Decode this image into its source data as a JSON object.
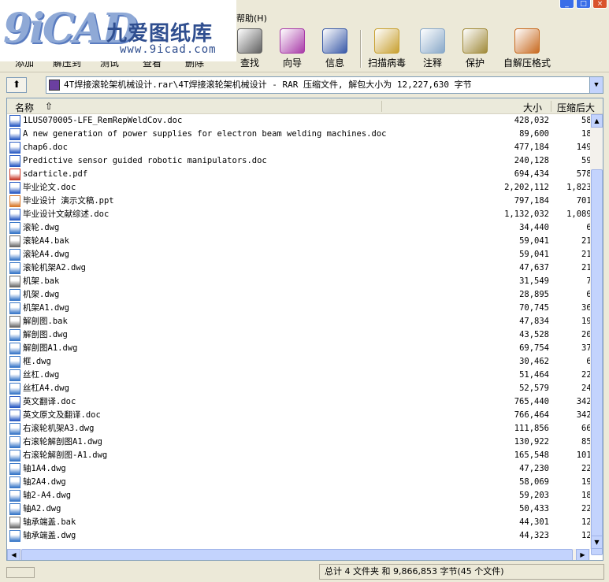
{
  "menu": {
    "help": "帮助(H)"
  },
  "logo": {
    "mark": "9iCAD",
    "cn": "九爱图纸库",
    "url": "www.9icad.com"
  },
  "toolbar": [
    {
      "label": "添加",
      "icon": "add-icon",
      "color": "#5b8a3a"
    },
    {
      "label": "解压到",
      "icon": "extract-icon",
      "color": "#8a6a3a"
    },
    {
      "label": "测试",
      "icon": "test-icon",
      "color": "#7a7a7a"
    },
    {
      "label": "查看",
      "icon": "view-icon",
      "color": "#4a6aa8"
    },
    {
      "label": "删除",
      "icon": "delete-icon",
      "color": "#a83a3a"
    },
    {
      "label": "查找",
      "icon": "find-icon",
      "color": "#606060"
    },
    {
      "label": "向导",
      "icon": "wizard-icon",
      "color": "#a83aa8"
    },
    {
      "label": "信息",
      "icon": "info-icon",
      "color": "#3a5aa8"
    },
    {
      "label": "扫描病毒",
      "icon": "virus-scan-icon",
      "color": "#c8a030"
    },
    {
      "label": "注释",
      "icon": "comment-icon",
      "color": "#88a8c8"
    },
    {
      "label": "保护",
      "icon": "protect-icon",
      "color": "#a08a3a"
    },
    {
      "label": "自解压格式",
      "icon": "sfx-icon",
      "color": "#c86a20"
    }
  ],
  "path": "4T焊接滚轮架机械设计.rar\\4T焊接滚轮架机械设计 - RAR 压缩文件, 解包大小为 12,227,630 字节",
  "columns": {
    "name": "名称",
    "size": "大小",
    "packed": "压缩后大"
  },
  "files": [
    {
      "name": "1LUS070005-LFE_RemRepWeldCov.doc",
      "size": "428,032",
      "packed": "58,",
      "type": "doc"
    },
    {
      "name": "A new generation of power supplies for electron beam welding machines.doc",
      "size": "89,600",
      "packed": "18,",
      "type": "doc"
    },
    {
      "name": "chap6.doc",
      "size": "477,184",
      "packed": "149,",
      "type": "doc"
    },
    {
      "name": "Predictive sensor guided robotic manipulators.doc",
      "size": "240,128",
      "packed": "59,",
      "type": "doc"
    },
    {
      "name": "sdarticle.pdf",
      "size": "694,434",
      "packed": "578,",
      "type": "pdf"
    },
    {
      "name": "毕业论文.doc",
      "size": "2,202,112",
      "packed": "1,823,",
      "type": "doc"
    },
    {
      "name": "毕业设计 演示文稿.ppt",
      "size": "797,184",
      "packed": "701,",
      "type": "ppt"
    },
    {
      "name": "毕业设计文献综述.doc",
      "size": "1,132,032",
      "packed": "1,089,",
      "type": "doc"
    },
    {
      "name": "滚轮.dwg",
      "size": "34,440",
      "packed": "6,",
      "type": "dwg"
    },
    {
      "name": "滚轮A4.bak",
      "size": "59,041",
      "packed": "21,",
      "type": "bak"
    },
    {
      "name": "滚轮A4.dwg",
      "size": "59,041",
      "packed": "21,",
      "type": "dwg"
    },
    {
      "name": "滚轮机架A2.dwg",
      "size": "47,637",
      "packed": "21,",
      "type": "dwg"
    },
    {
      "name": "机架.bak",
      "size": "31,549",
      "packed": "7,",
      "type": "bak"
    },
    {
      "name": "机架.dwg",
      "size": "28,895",
      "packed": "6,",
      "type": "dwg"
    },
    {
      "name": "机架A1.dwg",
      "size": "70,745",
      "packed": "36,",
      "type": "dwg"
    },
    {
      "name": "解剖图.bak",
      "size": "47,834",
      "packed": "19,",
      "type": "bak"
    },
    {
      "name": "解剖图.dwg",
      "size": "43,528",
      "packed": "20,",
      "type": "dwg"
    },
    {
      "name": "解剖图A1.dwg",
      "size": "69,754",
      "packed": "37,",
      "type": "dwg"
    },
    {
      "name": "框.dwg",
      "size": "30,462",
      "packed": "6,",
      "type": "dwg"
    },
    {
      "name": "丝杠.dwg",
      "size": "51,464",
      "packed": "22,",
      "type": "dwg"
    },
    {
      "name": "丝杠A4.dwg",
      "size": "52,579",
      "packed": "24,",
      "type": "dwg"
    },
    {
      "name": "英文翻译.doc",
      "size": "765,440",
      "packed": "342,",
      "type": "doc"
    },
    {
      "name": "英文原文及翻译.doc",
      "size": "766,464",
      "packed": "342,",
      "type": "doc"
    },
    {
      "name": "右滚轮机架A3.dwg",
      "size": "111,856",
      "packed": "66,",
      "type": "dwg"
    },
    {
      "name": "右滚轮解剖图A1.dwg",
      "size": "130,922",
      "packed": "85,",
      "type": "dwg"
    },
    {
      "name": "右滚轮解剖图-A1.dwg",
      "size": "165,548",
      "packed": "101,",
      "type": "dwg"
    },
    {
      "name": "轴1A4.dwg",
      "size": "47,230",
      "packed": "22,",
      "type": "dwg"
    },
    {
      "name": "轴2A4.dwg",
      "size": "58,069",
      "packed": "19,",
      "type": "dwg"
    },
    {
      "name": "轴2-A4.dwg",
      "size": "59,203",
      "packed": "18,",
      "type": "dwg"
    },
    {
      "name": "轴A2.dwg",
      "size": "50,433",
      "packed": "22,",
      "type": "dwg"
    },
    {
      "name": "轴承端盖.bak",
      "size": "44,301",
      "packed": "12,",
      "type": "bak"
    },
    {
      "name": "轴承端盖.dwg",
      "size": "44,323",
      "packed": "12,",
      "type": "dwg"
    }
  ],
  "icon_colors": {
    "doc": "#2b5cc4",
    "pdf": "#c83a2a",
    "ppt": "#d8782a",
    "dwg": "#3a78c8",
    "bak": "#6a6a6a"
  },
  "status": "总计 4 文件夹 和 9,866,853 字节(45 个文件)"
}
